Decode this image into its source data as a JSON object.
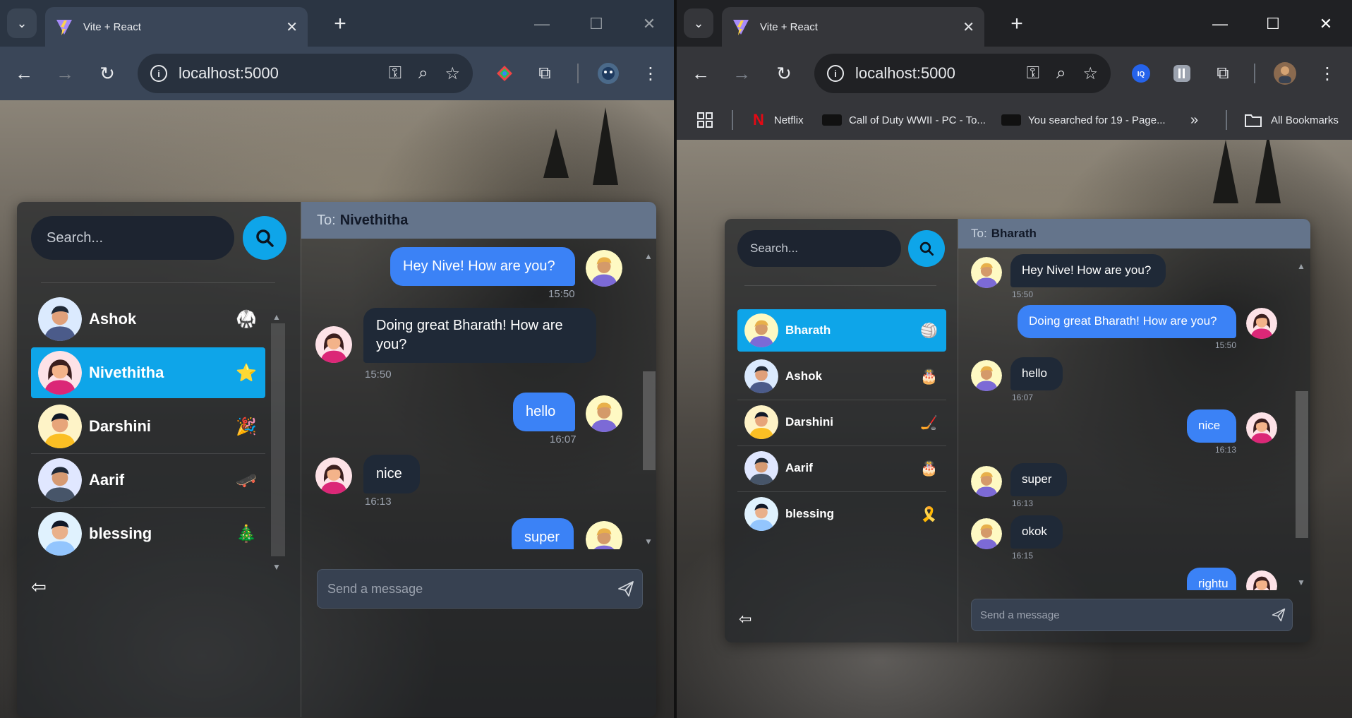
{
  "left": {
    "tab_title": "Vite + React",
    "url": "localhost:5000",
    "search_placeholder": "Search...",
    "chat_to_label": "To:",
    "chat_to_name": "Nivethitha",
    "composer_placeholder": "Send a message",
    "conversations": [
      {
        "name": "Ashok",
        "emoji": "🥋"
      },
      {
        "name": "Nivethitha",
        "emoji": "⭐"
      },
      {
        "name": "Darshini",
        "emoji": "🎉"
      },
      {
        "name": "Aarif",
        "emoji": "🛹"
      },
      {
        "name": "blessing",
        "emoji": "🎄"
      }
    ],
    "messages": [
      {
        "text": "Hey Nive! How are you?",
        "time": "15:50"
      },
      {
        "text": "Doing great Bharath! How are you?",
        "time": "15:50"
      },
      {
        "text": "hello",
        "time": "16:07"
      },
      {
        "text": "nice",
        "time": "16:13"
      },
      {
        "text": "super",
        "time": ""
      }
    ]
  },
  "right": {
    "tab_title": "Vite + React",
    "url": "localhost:5000",
    "bookmarks": [
      "Netflix",
      "Call of Duty WWII - PC - To...",
      "You searched for 19 - Page...",
      "All Bookmarks"
    ],
    "search_placeholder": "Search...",
    "chat_to_label": "To:",
    "chat_to_name": "Bharath",
    "composer_placeholder": "Send a message",
    "conversations": [
      {
        "name": "Bharath",
        "emoji": "🏐"
      },
      {
        "name": "Ashok",
        "emoji": "🎂"
      },
      {
        "name": "Darshini",
        "emoji": "🏒"
      },
      {
        "name": "Aarif",
        "emoji": "🎂"
      },
      {
        "name": "blessing",
        "emoji": "🎗️"
      }
    ],
    "messages": [
      {
        "text": "Hey Nive! How are you?",
        "time": "15:50"
      },
      {
        "text": "Doing great Bharath! How are you?",
        "time": "15:50"
      },
      {
        "text": "hello",
        "time": "16:07"
      },
      {
        "text": "nice",
        "time": "16:13"
      },
      {
        "text": "super",
        "time": "16:13"
      },
      {
        "text": "okok",
        "time": "16:15"
      },
      {
        "text": "rightu",
        "time": ""
      }
    ]
  },
  "colors": {
    "accent": "#0ea5e9",
    "own_bubble": "#3b82f6",
    "other_bubble": "#1f2937",
    "chat_header": "#64748b"
  },
  "icons": [
    "search-icon",
    "logout-icon",
    "send-icon",
    "key-icon",
    "zoom-icon",
    "star-icon",
    "extensions-icon",
    "menu-icon"
  ]
}
